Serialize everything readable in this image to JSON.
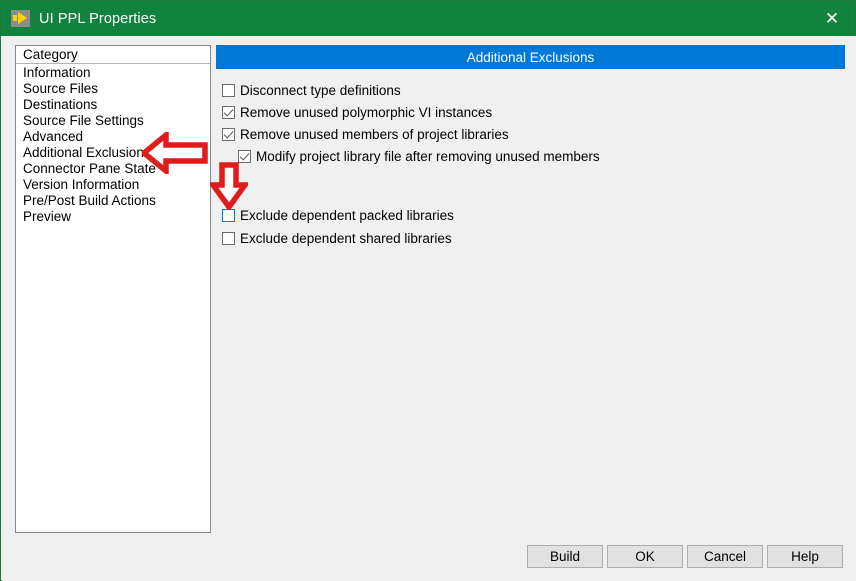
{
  "window": {
    "title": "UI PPL Properties",
    "icon": "labview-vi-icon",
    "close_label": "✕",
    "titlebar_color": "#12823f",
    "border_color": "#1a7a3c"
  },
  "category": {
    "header": "Category",
    "items": [
      {
        "label": "Information",
        "selected": false
      },
      {
        "label": "Source Files",
        "selected": false
      },
      {
        "label": "Destinations",
        "selected": false
      },
      {
        "label": "Source File Settings",
        "selected": false
      },
      {
        "label": "Advanced",
        "selected": false
      },
      {
        "label": "Additional Exclusions",
        "selected": true
      },
      {
        "label": "Connector Pane State",
        "selected": false
      },
      {
        "label": "Version Information",
        "selected": false
      },
      {
        "label": "Pre/Post Build Actions",
        "selected": false
      },
      {
        "label": "Preview",
        "selected": false
      }
    ],
    "selected_color": "#0078d7"
  },
  "pane": {
    "header": "Additional Exclusions",
    "header_color": "#0078d7",
    "options": [
      {
        "label": "Disconnect type definitions",
        "checked": false,
        "indent": false,
        "focused": false
      },
      {
        "label": "Remove unused polymorphic VI instances",
        "checked": true,
        "indent": false,
        "focused": false
      },
      {
        "label": "Remove unused members of project libraries",
        "checked": true,
        "indent": false,
        "focused": false
      },
      {
        "label": "Modify project library file after removing unused members",
        "checked": true,
        "indent": true,
        "focused": false
      },
      {
        "label": "Exclude dependent packed libraries",
        "checked": false,
        "indent": false,
        "focused": true
      },
      {
        "label": "Exclude dependent shared libraries",
        "checked": false,
        "indent": false,
        "focused": false
      }
    ]
  },
  "annotations": {
    "color": "#e01b1b",
    "arrows": [
      {
        "name": "left-pointing-arrow",
        "direction": "left"
      },
      {
        "name": "down-pointing-arrow",
        "direction": "down"
      }
    ]
  },
  "buttons": [
    {
      "label": "Build"
    },
    {
      "label": "OK"
    },
    {
      "label": "Cancel"
    },
    {
      "label": "Help"
    }
  ]
}
